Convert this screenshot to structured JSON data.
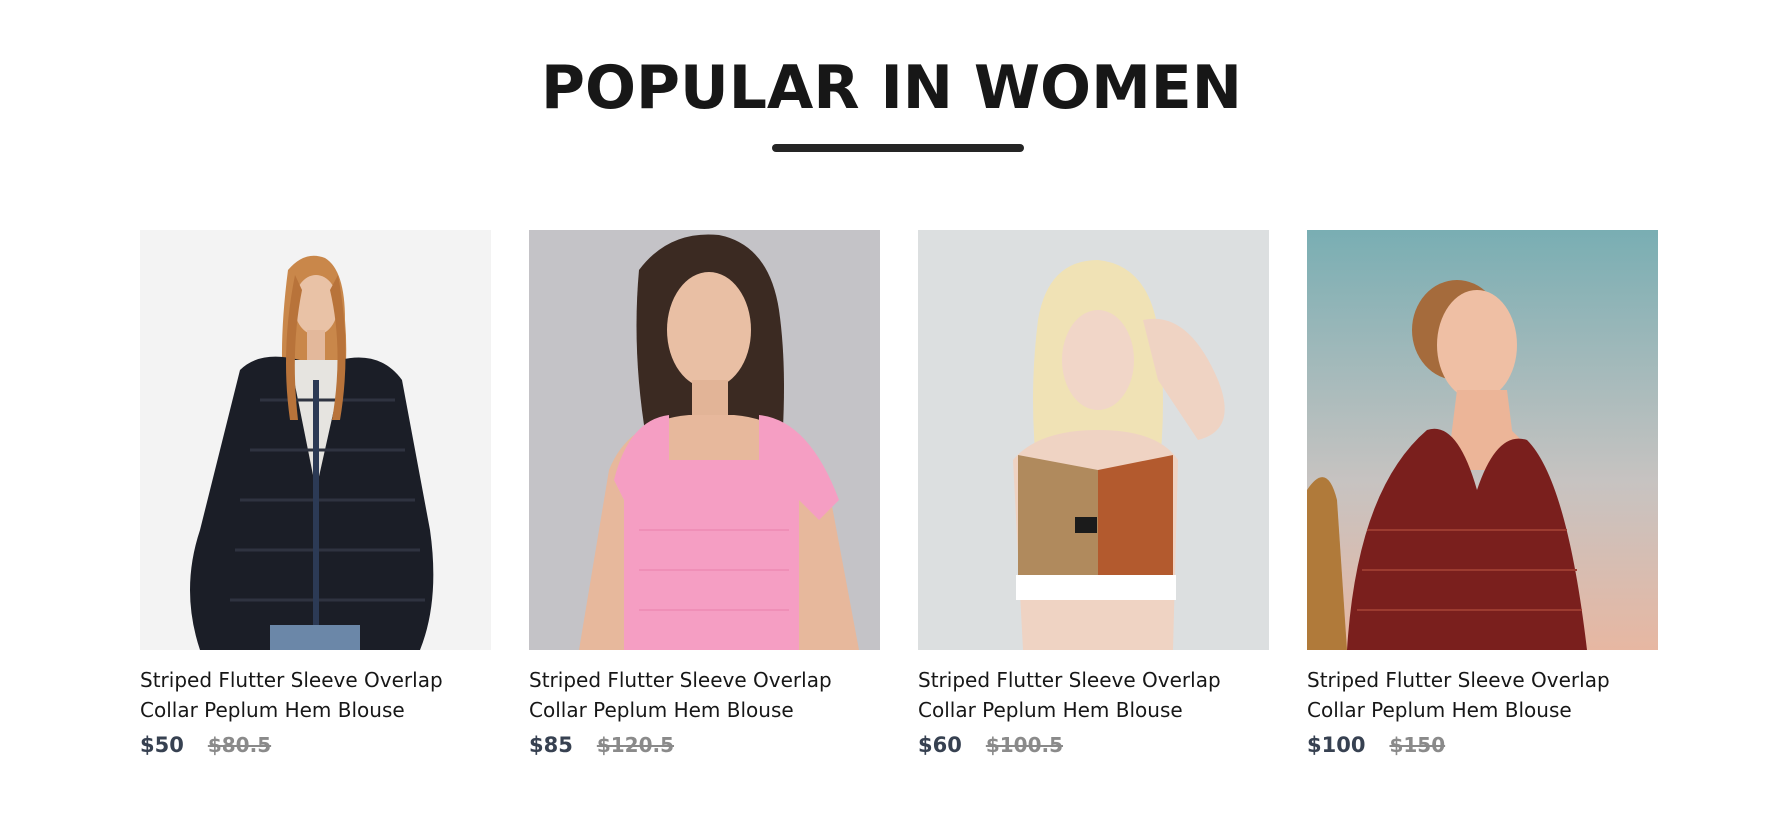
{
  "section": {
    "title": "POPULAR IN WOMEN"
  },
  "products": [
    {
      "name": "Striped Flutter Sleeve Overlap Collar Peplum Hem Blouse",
      "new_price": "$50",
      "old_price": "$80.5",
      "image": "woman-black-fur-jacket"
    },
    {
      "name": "Striped Flutter Sleeve Overlap Collar Peplum Hem Blouse",
      "new_price": "$85",
      "old_price": "$120.5",
      "image": "woman-pink-top"
    },
    {
      "name": "Striped Flutter Sleeve Overlap Collar Peplum Hem Blouse",
      "new_price": "$60",
      "old_price": "$100.5",
      "image": "woman-sports-bra"
    },
    {
      "name": "Striped Flutter Sleeve Overlap Collar Peplum Hem Blouse",
      "new_price": "$100",
      "old_price": "$150",
      "image": "woman-red-wrap-dress"
    }
  ],
  "colors": {
    "title": "#171717",
    "underline": "#252525",
    "new_price": "#374151",
    "old_price": "#8a8a8a"
  }
}
